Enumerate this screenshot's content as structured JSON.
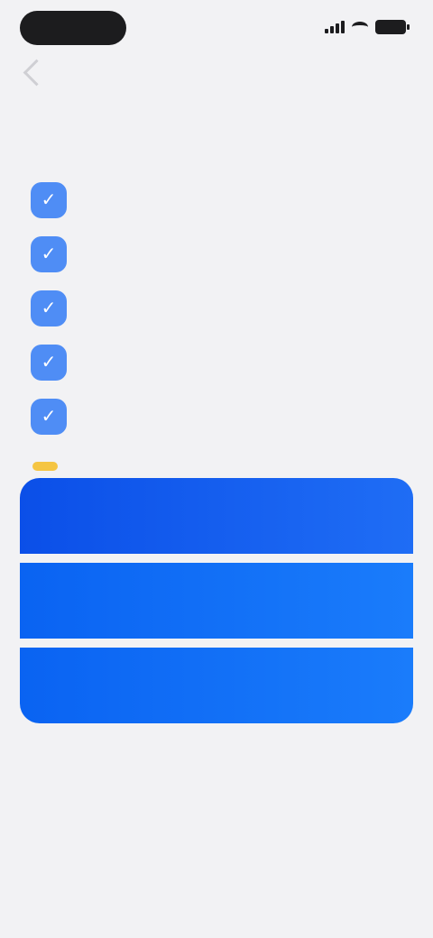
{
  "status_bar": {
    "time": ""
  },
  "nav": {
    "title": ""
  },
  "headline": "",
  "features": [
    {
      "icon": "feature-icon-1",
      "text": ""
    },
    {
      "icon": "feature-icon-2",
      "text": ""
    },
    {
      "icon": "feature-icon-3",
      "text": ""
    },
    {
      "icon": "feature-icon-4",
      "text": ""
    },
    {
      "icon": "feature-icon-5",
      "text": ""
    }
  ],
  "badge": "",
  "plans": [
    {
      "name": "",
      "price": ""
    },
    {
      "name": "",
      "price": ""
    },
    {
      "name": "",
      "price": ""
    }
  ],
  "footer": {
    "line": "",
    "links": [
      "",
      "",
      "",
      "",
      ""
    ]
  },
  "bottom_cta": "",
  "colors": {
    "accent": "#1a7cfb",
    "feature_icon": "#4f8df5",
    "badge": "#f5c542",
    "background": "#f2f2f4"
  }
}
